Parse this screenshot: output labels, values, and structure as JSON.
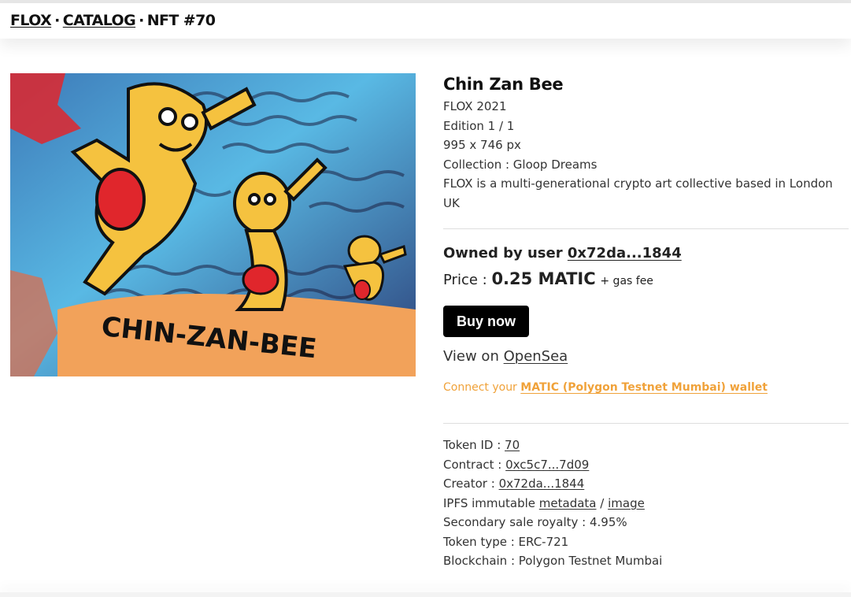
{
  "breadcrumb": {
    "home": "FLOX",
    "sep1": "·",
    "catalog": "CATALOG",
    "sep2": "·",
    "current": "NFT #70"
  },
  "artwork": {
    "caption_painted": "CHIN-ZAN-BEE",
    "palette": {
      "sky": "#4aa7d6",
      "figure": "#f5c23f",
      "red": "#e0262c",
      "ink": "#1a1a1a",
      "ground": "#2f3f7a"
    }
  },
  "nft": {
    "title": "Chin Zan Bee",
    "artist_year": "FLOX 2021",
    "edition": "Edition 1 / 1",
    "dimensions": "995 x 746 px",
    "collection": "Collection : Gloop Dreams",
    "description": "FLOX is a multi-generational crypto art collective based in London UK"
  },
  "ownership": {
    "owned_label": "Owned by user",
    "owner": "0x72da...1844",
    "price_label": "Price :",
    "price": "0.25 MATIC",
    "gas": "+ gas fee",
    "buy_button": "Buy now",
    "view_on_label": "View on",
    "opensea": "OpenSea",
    "connect_label": "Connect your",
    "connect_link": "MATIC (Polygon Testnet Mumbai) wallet"
  },
  "token": {
    "id_label": "Token ID :",
    "id": "70",
    "contract_label": "Contract :",
    "contract": "0xc5c7...7d09",
    "creator_label": "Creator :",
    "creator": "0x72da...1844",
    "ipfs_label": "IPFS immutable",
    "metadata": "metadata",
    "slash": "/",
    "image": "image",
    "royalty": "Secondary sale royalty : 4.95%",
    "type": "Token type : ERC-721",
    "blockchain": "Blockchain : Polygon Testnet Mumbai"
  },
  "colors": {
    "accent_connect": "#f0a23a",
    "button_bg": "#000000",
    "text": "#222222"
  }
}
